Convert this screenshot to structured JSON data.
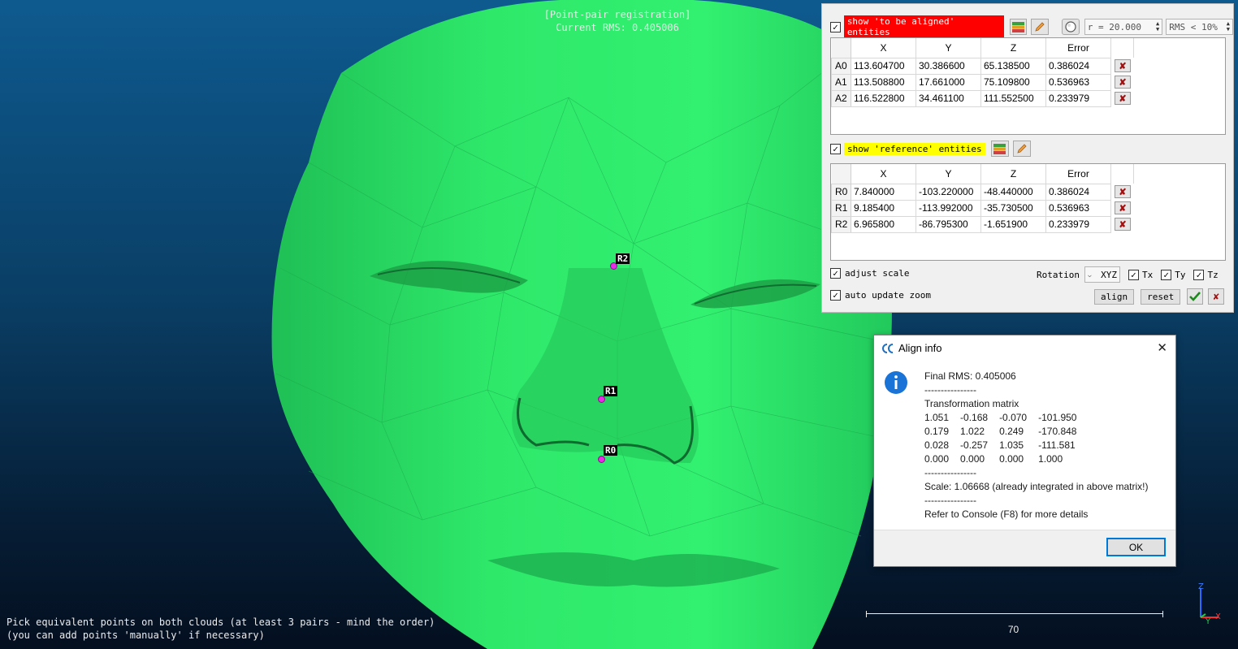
{
  "viewport": {
    "title_line1": "[Point-pair registration]",
    "title_line2": "Current RMS: 0.405006",
    "hint_line1": "Pick equivalent points on both clouds (at least 3 pairs - mind the order)",
    "hint_line2": "(you can add points 'manually' if necessary)",
    "scale_value": "70",
    "axis_z": "Z",
    "axis_y": "Y",
    "axis_x": "X",
    "points": [
      {
        "label": "R2"
      },
      {
        "label": "R1"
      },
      {
        "label": "R0"
      }
    ]
  },
  "panel": {
    "show_aligned_label": "show 'to be aligned' entities",
    "show_aligned_checked": true,
    "radius_value": "r = 20.000",
    "rms_value": "RMS < 10%",
    "aligned_table": {
      "headers": [
        "X",
        "Y",
        "Z",
        "Error"
      ],
      "rows": [
        {
          "id": "A0",
          "x": "113.604700",
          "y": "30.386600",
          "z": "65.138500",
          "err": "0.386024"
        },
        {
          "id": "A1",
          "x": "113.508800",
          "y": "17.661000",
          "z": "75.109800",
          "err": "0.536963"
        },
        {
          "id": "A2",
          "x": "116.522800",
          "y": "34.461100",
          "z": "111.552500",
          "err": "0.233979"
        }
      ]
    },
    "show_reference_label": "show 'reference' entities",
    "show_reference_checked": true,
    "reference_table": {
      "headers": [
        "X",
        "Y",
        "Z",
        "Error"
      ],
      "rows": [
        {
          "id": "R0",
          "x": "7.840000",
          "y": "-103.220000",
          "z": "-48.440000",
          "err": "0.386024"
        },
        {
          "id": "R1",
          "x": "9.185400",
          "y": "-113.992000",
          "z": "-35.730500",
          "err": "0.536963"
        },
        {
          "id": "R2",
          "x": "6.965800",
          "y": "-86.795300",
          "z": "-1.651900",
          "err": "0.233979"
        }
      ]
    },
    "adjust_scale_label": "adjust scale",
    "auto_update_zoom_label": "auto update zoom",
    "rotation_label": "Rotation",
    "rotation_value": "XYZ",
    "tx_label": "Tx",
    "ty_label": "Ty",
    "tz_label": "Tz",
    "align_label": "align",
    "reset_label": "reset"
  },
  "dialog": {
    "title": "Align info",
    "final_rms": "Final RMS: 0.405006",
    "sep1": "----------------",
    "matrix_title": "Transformation matrix",
    "matrix": [
      [
        "1.051",
        "-0.168",
        "-0.070",
        "-101.950"
      ],
      [
        "0.179",
        "1.022",
        "0.249",
        "-170.848"
      ],
      [
        "0.028",
        "-0.257",
        "1.035",
        "-111.581"
      ],
      [
        "0.000",
        "0.000",
        "0.000",
        "1.000"
      ]
    ],
    "sep2": "----------------",
    "scale_text": "Scale: 1.06668 (already integrated in above matrix!)",
    "sep3": "----------------",
    "console_text": "Refer to Console (F8) for more details",
    "ok_label": "OK"
  },
  "colors": {
    "face": "#2ee86a",
    "point": "#e62ee6",
    "aligned_tag": "#ff0000",
    "reference_tag": "#ffff00",
    "accent": "#0078d7"
  }
}
